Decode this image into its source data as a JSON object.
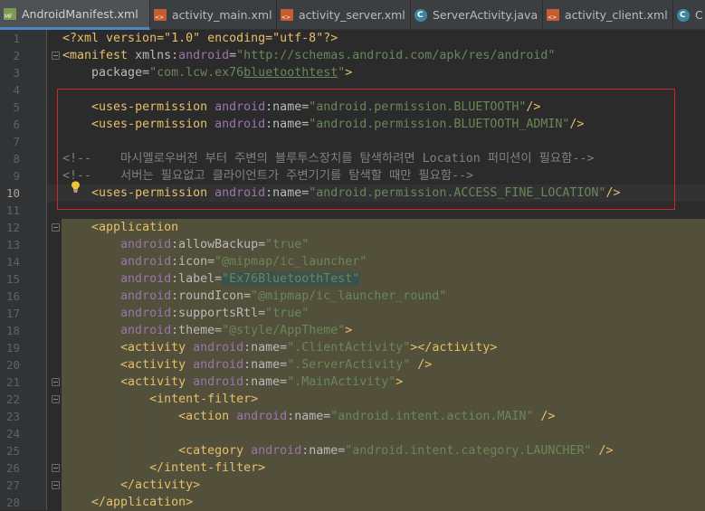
{
  "tabs": [
    {
      "label": "AndroidManifest.xml",
      "icon": "manifest-file-icon",
      "active": true,
      "closable": true
    },
    {
      "label": "activity_main.xml",
      "icon": "xml-file-icon",
      "active": false,
      "closable": true
    },
    {
      "label": "activity_server.xml",
      "icon": "xml-file-icon",
      "active": false,
      "closable": true
    },
    {
      "label": "ServerActivity.java",
      "icon": "java-class-icon",
      "active": false,
      "closable": true
    },
    {
      "label": "activity_client.xml",
      "icon": "xml-file-icon",
      "active": false,
      "closable": true
    },
    {
      "label": "C",
      "icon": "java-class-icon",
      "active": false,
      "closable": false
    }
  ],
  "current_line": 10,
  "lines": [
    {
      "n": "1",
      "tokens": [
        [
          "pi",
          "<?xml version=\"1.0\" encoding=\"utf-8\"?>"
        ]
      ]
    },
    {
      "n": "2",
      "tokens": [
        [
          "t",
          "<manifest "
        ],
        [
          "a",
          "xmlns:"
        ],
        [
          "ns",
          "android"
        ],
        [
          "a",
          "="
        ],
        [
          "v",
          "\"http://schemas.android.com/apk/res/android\""
        ]
      ]
    },
    {
      "n": "3",
      "tokens": [
        [
          "p",
          "    "
        ],
        [
          "a",
          "package"
        ],
        [
          "a",
          "="
        ],
        [
          "v",
          "\"com.lcw.ex76"
        ],
        [
          "vu",
          "bluetoothtest"
        ],
        [
          "v",
          "\""
        ],
        [
          "t",
          ">"
        ]
      ]
    },
    {
      "n": "4",
      "tokens": []
    },
    {
      "n": "5",
      "tokens": [
        [
          "p",
          "    "
        ],
        [
          "t",
          "<uses-permission "
        ],
        [
          "ns",
          "android"
        ],
        [
          "a",
          ":name="
        ],
        [
          "v",
          "\"android.permission.BLUETOOTH\""
        ],
        [
          "t",
          "/>"
        ]
      ]
    },
    {
      "n": "6",
      "tokens": [
        [
          "p",
          "    "
        ],
        [
          "t",
          "<uses-permission "
        ],
        [
          "ns",
          "android"
        ],
        [
          "a",
          ":name="
        ],
        [
          "v",
          "\"android.permission.BLUETOOTH_ADMIN\""
        ],
        [
          "t",
          "/>"
        ]
      ]
    },
    {
      "n": "7",
      "tokens": []
    },
    {
      "n": "8",
      "tokens": [
        [
          "cm",
          "<!--    마시멜로우버전 부터 주변의 블루투스장치를 탐색하려면 Location 퍼미션이 필요함-->"
        ]
      ]
    },
    {
      "n": "9",
      "tokens": [
        [
          "cm",
          "<!--    서버는 필요없고 클라이언트가 주변기기를 탐색할 때만 필요함-->"
        ]
      ]
    },
    {
      "n": "10",
      "tokens": [
        [
          "p",
          "    "
        ],
        [
          "t",
          "<uses-permission "
        ],
        [
          "ns",
          "android"
        ],
        [
          "a",
          ":name="
        ],
        [
          "v",
          "\"android.permission.ACCESS_FINE_LOCATION\""
        ],
        [
          "t",
          "/>"
        ]
      ]
    },
    {
      "n": "11",
      "tokens": []
    },
    {
      "n": "12",
      "tokens": [
        [
          "p",
          "    "
        ],
        [
          "t",
          "<application"
        ]
      ]
    },
    {
      "n": "13",
      "tokens": [
        [
          "p",
          "        "
        ],
        [
          "ns",
          "android"
        ],
        [
          "a",
          ":allowBackup="
        ],
        [
          "v",
          "\"true\""
        ]
      ]
    },
    {
      "n": "14",
      "tokens": [
        [
          "p",
          "        "
        ],
        [
          "ns",
          "android"
        ],
        [
          "a",
          ":icon="
        ],
        [
          "v",
          "\"@mipmap/ic_launcher\""
        ]
      ]
    },
    {
      "n": "15",
      "tokens": [
        [
          "p",
          "        "
        ],
        [
          "ns",
          "android"
        ],
        [
          "a",
          ":label="
        ],
        [
          "vs",
          "\"Ex76BluetoothTest\""
        ]
      ]
    },
    {
      "n": "16",
      "tokens": [
        [
          "p",
          "        "
        ],
        [
          "ns",
          "android"
        ],
        [
          "a",
          ":roundIcon="
        ],
        [
          "v",
          "\"@mipmap/ic_launcher_round\""
        ]
      ]
    },
    {
      "n": "17",
      "tokens": [
        [
          "p",
          "        "
        ],
        [
          "ns",
          "android"
        ],
        [
          "a",
          ":supportsRtl="
        ],
        [
          "v",
          "\"true\""
        ]
      ]
    },
    {
      "n": "18",
      "tokens": [
        [
          "p",
          "        "
        ],
        [
          "ns",
          "android"
        ],
        [
          "a",
          ":theme="
        ],
        [
          "v",
          "\"@style/AppTheme\""
        ],
        [
          "t",
          ">"
        ]
      ]
    },
    {
      "n": "19",
      "tokens": [
        [
          "p",
          "        "
        ],
        [
          "t",
          "<activity "
        ],
        [
          "ns",
          "android"
        ],
        [
          "a",
          ":name="
        ],
        [
          "v",
          "\".ClientActivity\""
        ],
        [
          "t",
          "></activity>"
        ]
      ]
    },
    {
      "n": "20",
      "tokens": [
        [
          "p",
          "        "
        ],
        [
          "t",
          "<activity "
        ],
        [
          "ns",
          "android"
        ],
        [
          "a",
          ":name="
        ],
        [
          "v",
          "\".ServerActivity\""
        ],
        [
          "t",
          " />"
        ]
      ]
    },
    {
      "n": "21",
      "tokens": [
        [
          "p",
          "        "
        ],
        [
          "t",
          "<activity "
        ],
        [
          "ns",
          "android"
        ],
        [
          "a",
          ":name="
        ],
        [
          "v",
          "\".MainActivity\""
        ],
        [
          "t",
          ">"
        ]
      ]
    },
    {
      "n": "22",
      "tokens": [
        [
          "p",
          "            "
        ],
        [
          "t",
          "<intent-filter>"
        ]
      ]
    },
    {
      "n": "23",
      "tokens": [
        [
          "p",
          "                "
        ],
        [
          "t",
          "<action "
        ],
        [
          "ns",
          "android"
        ],
        [
          "a",
          ":name="
        ],
        [
          "v",
          "\"android.intent.action.MAIN\""
        ],
        [
          "t",
          " />"
        ]
      ]
    },
    {
      "n": "24",
      "tokens": []
    },
    {
      "n": "25",
      "tokens": [
        [
          "p",
          "                "
        ],
        [
          "t",
          "<category "
        ],
        [
          "ns",
          "android"
        ],
        [
          "a",
          ":name="
        ],
        [
          "v",
          "\"android.intent.category.LAUNCHER\""
        ],
        [
          "t",
          " />"
        ]
      ]
    },
    {
      "n": "26",
      "tokens": [
        [
          "p",
          "            "
        ],
        [
          "t",
          "</intent-filter>"
        ]
      ]
    },
    {
      "n": "27",
      "tokens": [
        [
          "p",
          "        "
        ],
        [
          "t",
          "</activity>"
        ]
      ]
    },
    {
      "n": "28",
      "tokens": [
        [
          "p",
          "    "
        ],
        [
          "t",
          "</application>"
        ]
      ]
    }
  ],
  "colors": {
    "editor_bg": "#2b2b2b",
    "gutter_bg": "#313335",
    "tag": "#e8bf6a",
    "attr": "#bababa",
    "namespace": "#9876aa",
    "value": "#6a8759",
    "comment": "#808080",
    "highlight_block": "#52503a",
    "current_line": "#323232",
    "annotation_box": "#d02525"
  }
}
